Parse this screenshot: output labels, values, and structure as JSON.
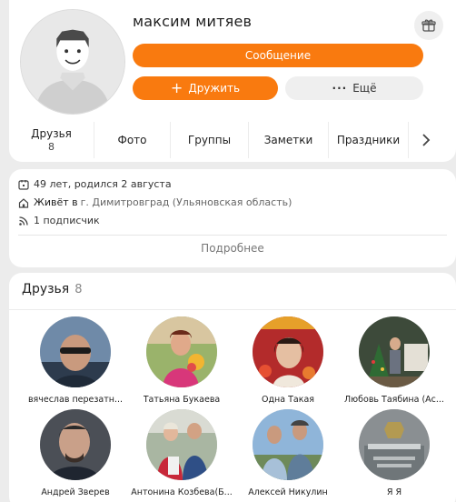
{
  "profile": {
    "name": "максим митяев",
    "message_label": "Сообщение",
    "friend_label": "Дружить",
    "more_label": "Ещё",
    "more_dots": "···"
  },
  "tabs": [
    {
      "label": "Друзья",
      "count": "8"
    },
    {
      "label": "Фото"
    },
    {
      "label": "Группы"
    },
    {
      "label": "Заметки"
    },
    {
      "label": "Праздники"
    }
  ],
  "info": {
    "age": "49 лет, родился 2 августа",
    "lives_prefix": "Живёт в",
    "lives_city": "г. Димитровград (Ульяновская область)",
    "subscribers": "1 подписчик",
    "more_link": "Подробнее"
  },
  "friends_section": {
    "title": "Друзья",
    "count": "8",
    "items": [
      {
        "name": "вячеслав перезатн..."
      },
      {
        "name": "Татьяна Букаева"
      },
      {
        "name": "Одна Такая"
      },
      {
        "name": "Любовь Таябина (Ас..."
      },
      {
        "name": "Андрей Зверев"
      },
      {
        "name": "Антонина Козбева(Б..."
      },
      {
        "name": "Алексей Никулин"
      },
      {
        "name": "Я Я"
      }
    ]
  },
  "icons": {
    "gift": "gift-icon",
    "calendar": "calendar-icon",
    "home": "home-icon",
    "subscribers": "rss-icon",
    "arrow": "chevron-right-icon"
  },
  "colors": {
    "accent": "#f97a0f",
    "bg": "#ececec"
  }
}
